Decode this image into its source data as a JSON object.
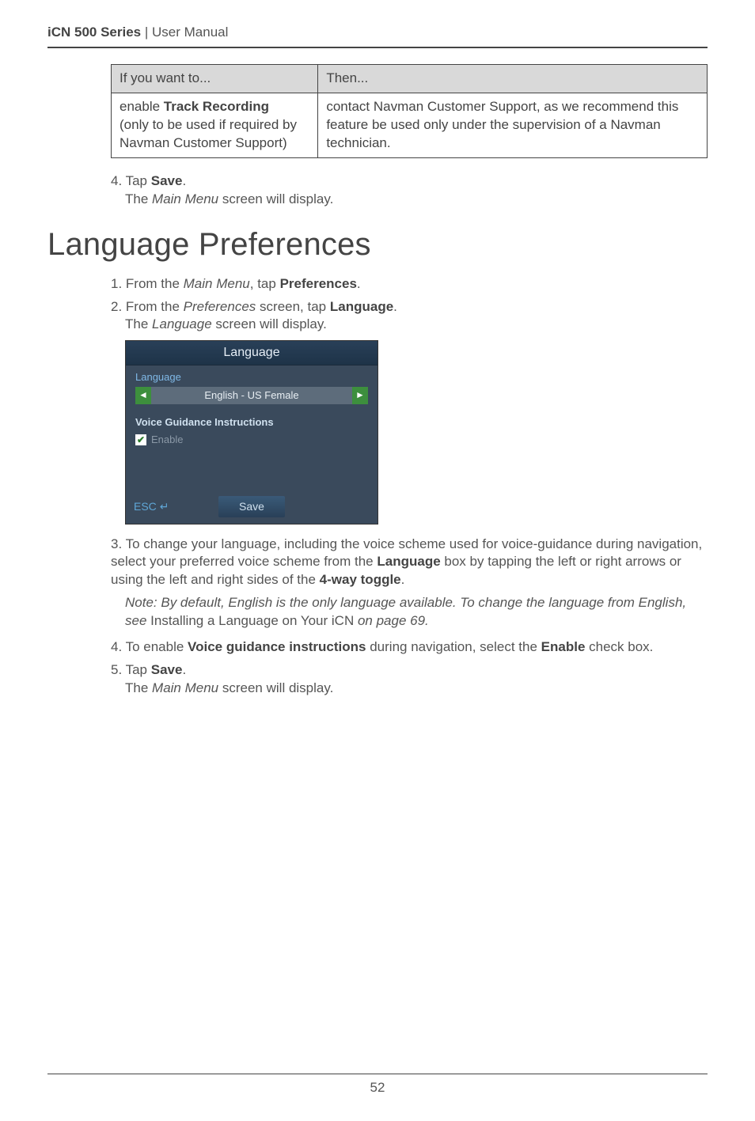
{
  "header": {
    "product": "iCN 500 Series",
    "sep": " | ",
    "doc": "User Manual"
  },
  "table": {
    "h1": "If you want to...",
    "h2": "Then...",
    "r1c1_a": "enable ",
    "r1c1_b": "Track Recording",
    "r1c1_c": "(only to be used if required by Navman Customer Support)",
    "r1c2": "contact Navman Customer Support, as we recommend this feature be used only under the supervision of a Navman technician."
  },
  "s4": {
    "num": "4. Tap ",
    "save": "Save",
    "dot": ".",
    "sub_a": "The ",
    "sub_b": "Main Menu",
    "sub_c": " screen will display."
  },
  "h1": "Language Preferences",
  "p1": {
    "num": "1. From the ",
    "mm": "Main Menu",
    "mid": ", tap ",
    "pref": "Preferences",
    "dot": "."
  },
  "p2": {
    "num": "2. From the ",
    "pref": "Preferences",
    "mid": " screen, tap ",
    "lang": "Language",
    "dot": ".",
    "sub_a": "The ",
    "sub_b": "Language",
    "sub_c": " screen will display."
  },
  "device": {
    "title": "Language",
    "grp1": "Language",
    "val": "English - US Female",
    "grp2": "Voice Guidance Instructions",
    "enable": "Enable",
    "esc": "ESC",
    "save": "Save"
  },
  "p3": {
    "a": "3. To change your language, including the voice scheme used for voice-guidance during navigation, select your preferred voice scheme from the ",
    "b": "Language",
    "c": " box by tapping the left or right arrows or using the left and right sides of the ",
    "d": "4-way toggle",
    "e": "."
  },
  "note": {
    "a": "Note: By default, English is the only language available. To change the language from English, see ",
    "b": "Installing a Language on Your iCN",
    "c": " on page 69."
  },
  "p4": {
    "a": "4. To enable ",
    "b": "Voice guidance instructions",
    "c": " during navigation, select the ",
    "d": "Enable",
    "e": " check box."
  },
  "p5": {
    "a": "5. Tap ",
    "b": "Save",
    "c": ".",
    "sub_a": "The ",
    "sub_b": "Main Menu",
    "sub_c": " screen will display."
  },
  "footer": {
    "page": "52"
  }
}
